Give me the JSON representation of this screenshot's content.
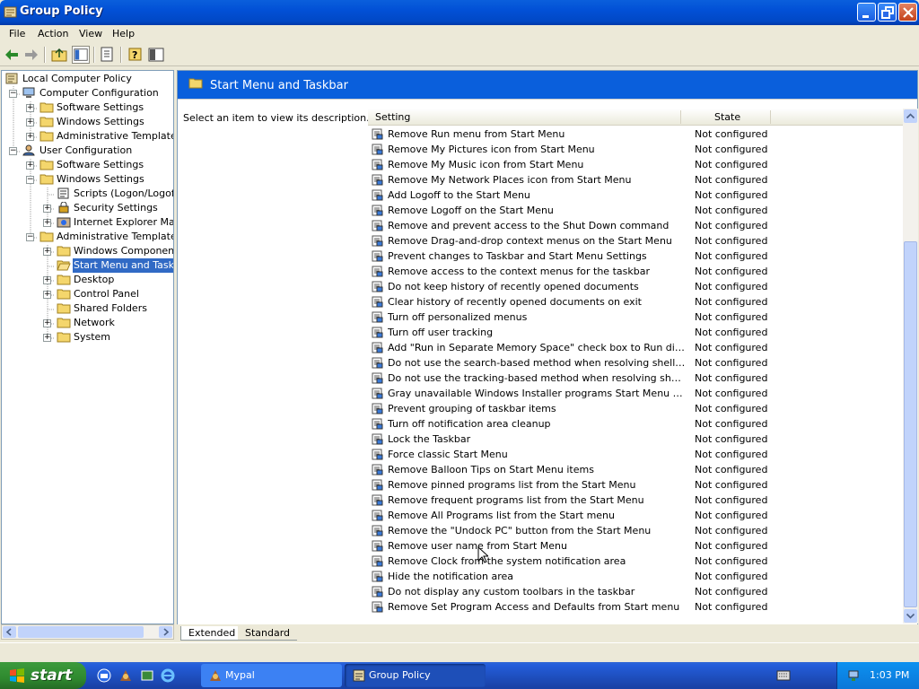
{
  "window": {
    "title": "Group Policy"
  },
  "menubar": {
    "items": [
      "File",
      "Action",
      "View",
      "Help"
    ]
  },
  "tree": {
    "nodes": [
      {
        "label": "Local Computer Policy"
      },
      {
        "label": "Computer Configuration"
      },
      {
        "label": "Software Settings"
      },
      {
        "label": "Windows Settings"
      },
      {
        "label": "Administrative Templates"
      },
      {
        "label": "User Configuration"
      },
      {
        "label": "Software Settings"
      },
      {
        "label": "Windows Settings"
      },
      {
        "label": "Scripts (Logon/Logoff)"
      },
      {
        "label": "Security Settings"
      },
      {
        "label": "Internet Explorer Maint"
      },
      {
        "label": "Administrative Templates"
      },
      {
        "label": "Windows Components"
      },
      {
        "label": "Start Menu and Taskba"
      },
      {
        "label": "Desktop"
      },
      {
        "label": "Control Panel"
      },
      {
        "label": "Shared Folders"
      },
      {
        "label": "Network"
      },
      {
        "label": "System"
      }
    ]
  },
  "details": {
    "header_title": "Start Menu and Taskbar",
    "description": "Select an item to view its description.",
    "columns": {
      "setting": "Setting",
      "state": "State"
    },
    "rows": [
      {
        "setting": "Remove Run menu from Start Menu",
        "state": "Not configured"
      },
      {
        "setting": "Remove My Pictures icon from Start Menu",
        "state": "Not configured"
      },
      {
        "setting": "Remove My Music icon from Start Menu",
        "state": "Not configured"
      },
      {
        "setting": "Remove My Network Places icon from Start Menu",
        "state": "Not configured"
      },
      {
        "setting": "Add Logoff to the Start Menu",
        "state": "Not configured"
      },
      {
        "setting": "Remove Logoff on the Start Menu",
        "state": "Not configured"
      },
      {
        "setting": "Remove and prevent access to the Shut Down command",
        "state": "Not configured"
      },
      {
        "setting": "Remove Drag-and-drop context menus on the Start Menu",
        "state": "Not configured"
      },
      {
        "setting": "Prevent changes to Taskbar and Start Menu Settings",
        "state": "Not configured"
      },
      {
        "setting": "Remove access to the context menus for the taskbar",
        "state": "Not configured"
      },
      {
        "setting": "Do not keep history of recently opened documents",
        "state": "Not configured"
      },
      {
        "setting": "Clear history of recently opened documents on exit",
        "state": "Not configured"
      },
      {
        "setting": "Turn off personalized menus",
        "state": "Not configured"
      },
      {
        "setting": "Turn off user tracking",
        "state": "Not configured"
      },
      {
        "setting": "Add \"Run in Separate Memory Space\" check box to Run dialog box",
        "state": "Not configured"
      },
      {
        "setting": "Do not use the search-based method when resolving shell shortcuts",
        "state": "Not configured"
      },
      {
        "setting": "Do not use the tracking-based method when resolving shell short...",
        "state": "Not configured"
      },
      {
        "setting": "Gray unavailable Windows Installer programs Start Menu shortcuts",
        "state": "Not configured"
      },
      {
        "setting": "Prevent grouping of taskbar items",
        "state": "Not configured"
      },
      {
        "setting": "Turn off notification area cleanup",
        "state": "Not configured"
      },
      {
        "setting": "Lock the Taskbar",
        "state": "Not configured"
      },
      {
        "setting": "Force classic Start Menu",
        "state": "Not configured"
      },
      {
        "setting": "Remove Balloon Tips on Start Menu items",
        "state": "Not configured"
      },
      {
        "setting": "Remove pinned programs list from the Start Menu",
        "state": "Not configured"
      },
      {
        "setting": "Remove frequent programs list from the Start Menu",
        "state": "Not configured"
      },
      {
        "setting": "Remove All Programs list from the Start menu",
        "state": "Not configured"
      },
      {
        "setting": "Remove the \"Undock PC\" button from the Start Menu",
        "state": "Not configured"
      },
      {
        "setting": "Remove user name from Start Menu",
        "state": "Not configured"
      },
      {
        "setting": "Remove Clock from the system notification area",
        "state": "Not configured"
      },
      {
        "setting": "Hide the notification area",
        "state": "Not configured"
      },
      {
        "setting": "Do not display any custom toolbars in the taskbar",
        "state": "Not configured"
      },
      {
        "setting": "Remove Set Program Access and Defaults from Start menu",
        "state": "Not configured"
      }
    ]
  },
  "tabs": [
    "Extended",
    "Standard"
  ],
  "taskbar": {
    "start_label": "start",
    "tasks": [
      "Mypal",
      "Group Policy"
    ],
    "clock": "1:03 PM"
  },
  "colors": {
    "title_blue": "#0a5fdc",
    "selection": "#316ac5",
    "start_green": "#3c9a3c"
  }
}
